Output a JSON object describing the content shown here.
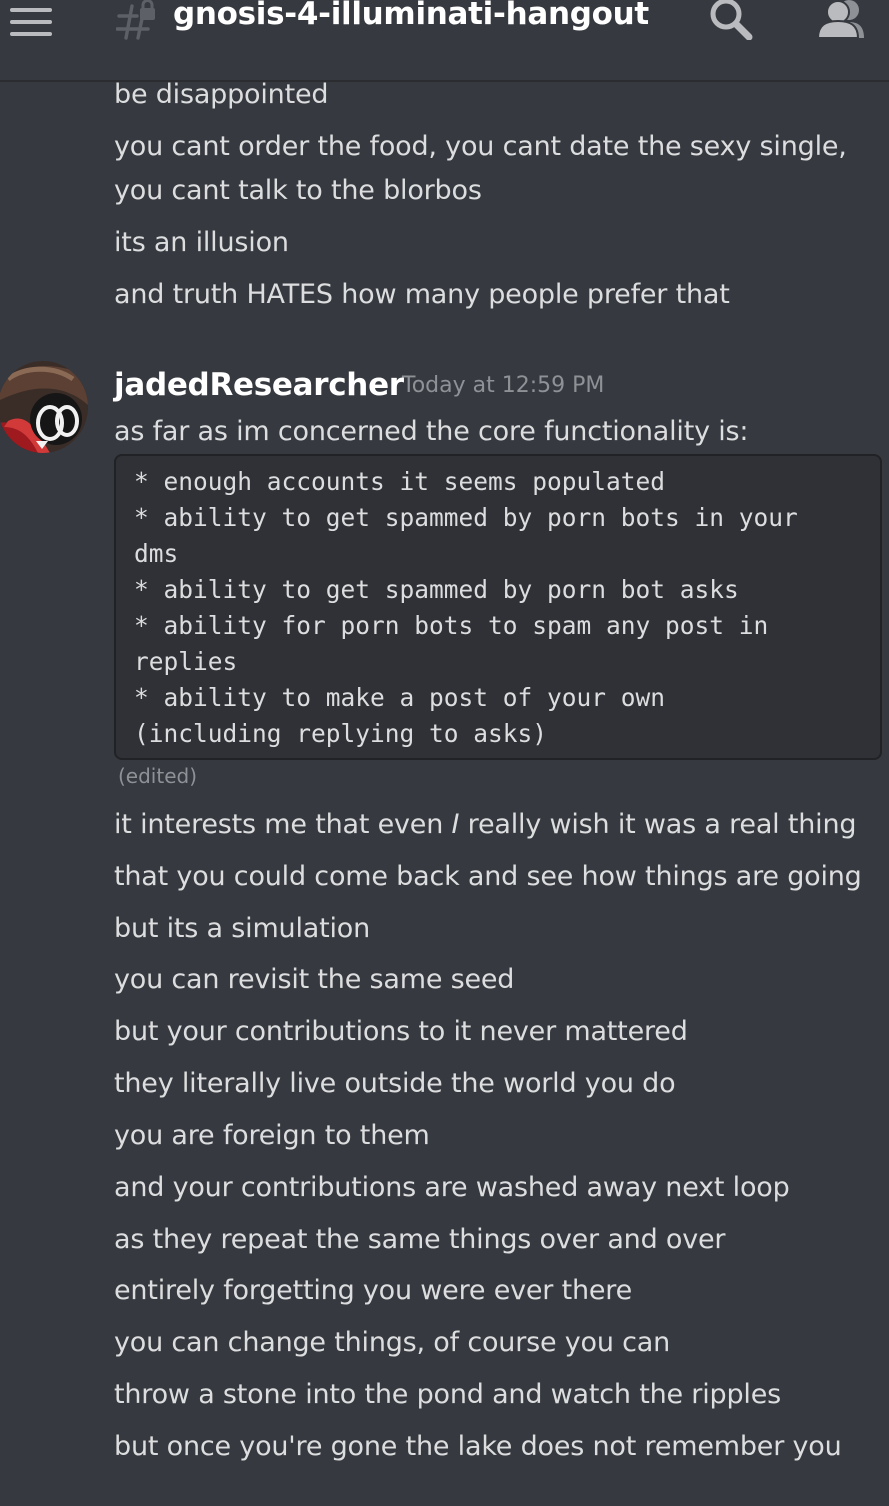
{
  "header": {
    "channel_name": "gnosis-4-illuminati-hangout",
    "icons": {
      "menu": "hamburger-menu-icon",
      "channel": "locked-text-channel-icon",
      "search": "search-icon",
      "members": "members-icon"
    }
  },
  "previous_message_lines": [
    "be disappointed",
    "you cant order the food, you cant date the sexy single,",
    "you cant talk to the blorbos",
    "its an illusion",
    "and truth HATES how many people prefer that"
  ],
  "message": {
    "author": "jadedResearcher",
    "timestamp": "Today at 12:59 PM",
    "intro": "as far as im concerned the core functionality is:",
    "code_lines": [
      "* enough accounts it seems populated",
      "* ability to get spammed by porn bots in your",
      "dms",
      "* ability to get spammed by porn bot asks",
      "* ability for porn bots to spam any post in",
      "replies",
      "* ability to make a post of your own",
      "(including replying to asks)"
    ],
    "edited_label": "(edited)",
    "follow_up": {
      "pre": "it interests me that even ",
      "emphasis": "I",
      "post": " really wish it was a real thing"
    },
    "lines": [
      "that you could come back and see how things are going",
      "but its a simulation",
      "you can revisit the same seed",
      "but your contributions to it never mattered",
      "they  literally live outside the world you do",
      "you are foreign to them",
      "and your contributions are washed away next loop",
      "as they repeat the same things over and over",
      "entirely forgetting you were ever there",
      "you can change things, of course you can",
      "throw a stone into the pond and watch the ripples",
      "but once you're gone the lake does not remember you"
    ]
  },
  "colors": {
    "background": "#36393f",
    "code_background": "#2f3136",
    "text": "#dcddde",
    "muted": "#8e9297",
    "username": "#ffffff"
  }
}
